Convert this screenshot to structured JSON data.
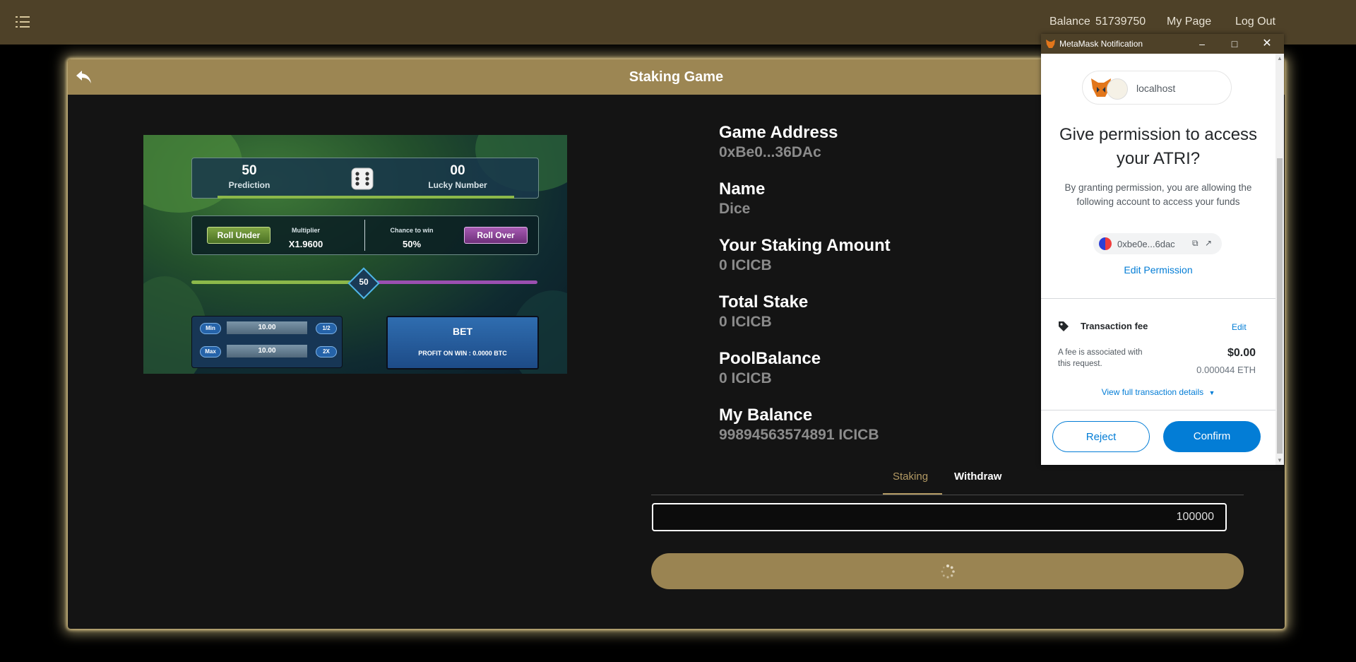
{
  "nav": {
    "balance_label": "Balance",
    "balance_value": "51739750",
    "my_page": "My Page",
    "log_out": "Log Out"
  },
  "card": {
    "title": "Staking Game"
  },
  "preview": {
    "prediction_value": "50",
    "prediction_label": "Prediction",
    "lucky_value": "00",
    "lucky_label": "Lucky Number",
    "roll_under": "Roll Under",
    "multiplier_label": "Multiplier",
    "multiplier_value": "X1.9600",
    "chance_label": "Chance to win",
    "chance_value": "50%",
    "roll_over": "Roll Over",
    "slider_value": "50",
    "min_label": "Min",
    "max_label": "Max",
    "half_label": "1/2",
    "double_label": "2X",
    "min_amount": "10.00",
    "max_amount": "10.00",
    "bet_label": "BET",
    "profit_text": "PROFIT ON WIN : 0.0000 BTC"
  },
  "info": [
    {
      "label": "Game Address",
      "value": "0xBe0...36DAc"
    },
    {
      "label": "Name",
      "value": "Dice"
    },
    {
      "label": "Your Staking Amount",
      "value": "0 ICICB"
    },
    {
      "label": "Total Stake",
      "value": "0 ICICB"
    },
    {
      "label": "PoolBalance",
      "value": "0 ICICB"
    },
    {
      "label": "My Balance",
      "value": "99894563574891 ICICB"
    }
  ],
  "tabs": {
    "staking": "Staking",
    "withdraw": "Withdraw"
  },
  "form": {
    "amount_value": "100000"
  },
  "metamask": {
    "window_title": "MetaMask Notification",
    "site": "localhost",
    "heading": "Give permission to access your ATRI?",
    "description": "By granting permission, you are allowing the following account to access your funds",
    "account": "0xbe0e...6dac",
    "edit_permission": "Edit Permission",
    "fee_title": "Transaction fee",
    "fee_edit": "Edit",
    "fee_note": "A fee is associated with this request.",
    "fee_usd": "$0.00",
    "fee_eth": "0.000044 ETH",
    "view_details": "View full transaction details",
    "reject": "Reject",
    "confirm": "Confirm"
  },
  "colors": {
    "nav_bg": "#4e4128",
    "gold": "#9c8653",
    "metamask_blue": "#037dd6"
  }
}
